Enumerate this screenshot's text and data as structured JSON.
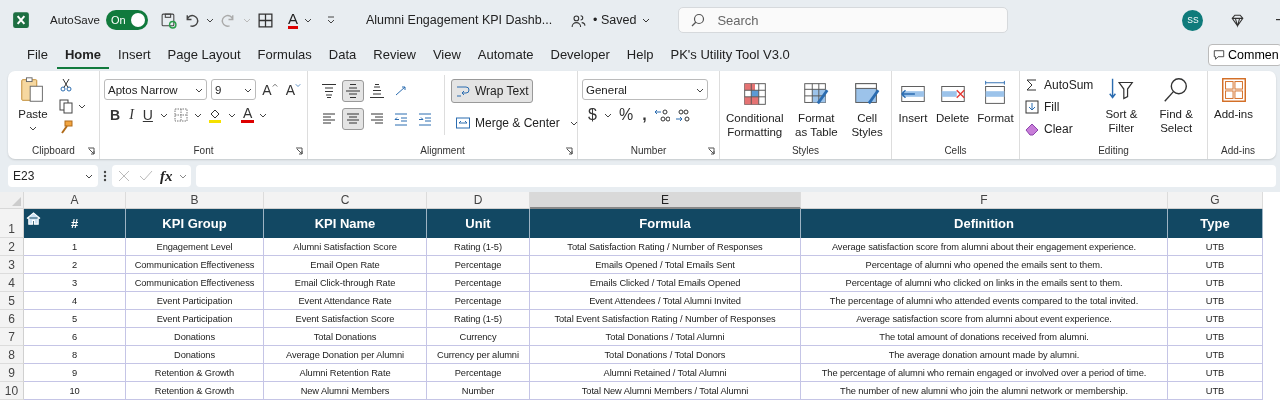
{
  "title_bar": {
    "autosave_label": "AutoSave",
    "autosave": {
      "on": true,
      "label": "On"
    },
    "font_color_glyph": "A",
    "document_title": "Alumni Engagement KPI Dashb...",
    "save_status": "• Saved",
    "search": {
      "placeholder": "Search"
    },
    "avatar": "SS"
  },
  "menu_tabs": [
    {
      "label": "File",
      "selected": false
    },
    {
      "label": "Home",
      "selected": true
    },
    {
      "label": "Insert",
      "selected": false
    },
    {
      "label": "Page Layout",
      "selected": false
    },
    {
      "label": "Formulas",
      "selected": false
    },
    {
      "label": "Data",
      "selected": false
    },
    {
      "label": "Review",
      "selected": false
    },
    {
      "label": "View",
      "selected": false
    },
    {
      "label": "Automate",
      "selected": false
    },
    {
      "label": "Developer",
      "selected": false
    },
    {
      "label": "Help",
      "selected": false
    },
    {
      "label": "PK's Utility Tool V3.0",
      "selected": false
    }
  ],
  "comments_button": "Commen",
  "ribbon": {
    "clipboard": {
      "paste": "Paste",
      "label": "Clipboard"
    },
    "font": {
      "font_name": "Aptos Narrow",
      "font_size": "9",
      "grow": "A",
      "shrink": "A",
      "bold": "B",
      "italic": "I",
      "underline": "U",
      "font_color": "A",
      "label": "Font"
    },
    "alignment": {
      "buttons": [
        {
          "kind": "top",
          "selected": false
        },
        {
          "kind": "middle",
          "selected": true
        },
        {
          "kind": "bottom",
          "selected": false
        },
        {
          "kind": "orientation",
          "selected": false
        },
        {
          "kind": "left",
          "selected": false
        },
        {
          "kind": "center",
          "selected": true
        },
        {
          "kind": "right",
          "selected": false
        },
        {
          "kind": "outdent",
          "selected": false
        },
        {
          "kind": "indent",
          "selected": false
        }
      ],
      "wrap_text": {
        "label": "Wrap Text",
        "selected": true
      },
      "merge": "Merge & Center",
      "label": "Alignment"
    },
    "number": {
      "format": "General",
      "currency": "$",
      "percent": "%",
      "comma": ",",
      "label": "Number"
    },
    "styles": {
      "buttons": [
        {
          "kind": "conditional",
          "label": "Conditional Formatting"
        },
        {
          "kind": "table",
          "label": "Format as Table"
        },
        {
          "kind": "cellstyles",
          "label": "Cell Styles"
        }
      ],
      "label": "Styles"
    },
    "cells": {
      "buttons": [
        {
          "kind": "insert",
          "label": "Insert"
        },
        {
          "kind": "delete",
          "label": "Delete"
        },
        {
          "kind": "format",
          "label": "Format"
        }
      ],
      "label": "Cells"
    },
    "editing": {
      "autosum": "AutoSum",
      "fill": "Fill",
      "clear": "Clear",
      "buttons": [
        {
          "kind": "sort",
          "label": "Sort & Filter"
        },
        {
          "kind": "find",
          "label": "Find & Select"
        }
      ],
      "label": "Editing"
    },
    "addins": {
      "button": "Add-ins",
      "label": "Add-ins"
    }
  },
  "formula_bar": {
    "name_box": "E23",
    "fx": "fx"
  },
  "sheet": {
    "columns": [
      {
        "letter": "A",
        "selected": false
      },
      {
        "letter": "B",
        "selected": false
      },
      {
        "letter": "C",
        "selected": false
      },
      {
        "letter": "D",
        "selected": false
      },
      {
        "letter": "E",
        "selected": true
      },
      {
        "letter": "F",
        "selected": false
      },
      {
        "letter": "G",
        "selected": false
      }
    ],
    "row_numbers": [
      "1",
      "2",
      "3",
      "4",
      "5",
      "6",
      "7",
      "8",
      "9",
      "10"
    ],
    "header": [
      "#",
      "KPI Group",
      "KPI Name",
      "Unit",
      "Formula",
      "Definition",
      "Type"
    ],
    "rows": [
      [
        "1",
        "Engagement Level",
        "Alumni Satisfaction Score",
        "Rating (1-5)",
        "Total Satisfaction Rating / Number of Responses",
        "Average satisfaction score from alumni about their engagement experience.",
        "UTB"
      ],
      [
        "2",
        "Communication Effectiveness",
        "Email Open Rate",
        "Percentage",
        "Emails Opened / Total Emails Sent",
        "Percentage of alumni who opened the emails sent to them.",
        "UTB"
      ],
      [
        "3",
        "Communication Effectiveness",
        "Email Click-through Rate",
        "Percentage",
        "Emails Clicked / Total Emails Opened",
        "Percentage of alumni who clicked on links in the emails sent to them.",
        "UTB"
      ],
      [
        "4",
        "Event Participation",
        "Event Attendance Rate",
        "Percentage",
        "Event Attendees / Total Alumni Invited",
        "The percentage of alumni who attended events compared to the total invited.",
        "UTB"
      ],
      [
        "5",
        "Event Participation",
        "Event Satisfaction Score",
        "Rating (1-5)",
        "Total Event Satisfaction Rating / Number of Responses",
        "Average satisfaction score from alumni about event experience.",
        "UTB"
      ],
      [
        "6",
        "Donations",
        "Total Donations",
        "Currency",
        "Total Donations / Total Alumni",
        "The total amount of donations received from alumni.",
        "UTB"
      ],
      [
        "8",
        "Donations",
        "Average Donation per Alumni",
        "Currency per alumni",
        "Total Donations / Total Donors",
        "The average donation amount made by alumni.",
        "UTB"
      ],
      [
        "9",
        "Retention & Growth",
        "Alumni Retention Rate",
        "Percentage",
        "Alumni Retained / Total Alumni",
        "The percentage of alumni who remain engaged or involved over a period of time.",
        "UTB"
      ],
      [
        "10",
        "Retention & Growth",
        "New Alumni Members",
        "Number",
        "Total New Alumni Members / Total Alumni",
        "The number of new alumni who join the alumni network or membership.",
        "UTB"
      ]
    ]
  }
}
